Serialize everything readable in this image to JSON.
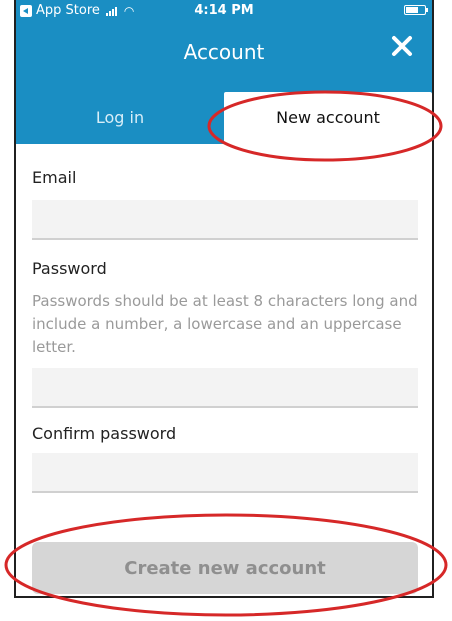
{
  "status_bar": {
    "left_label": "App Store",
    "time": "4:14 PM"
  },
  "header": {
    "title": "Account",
    "close_icon": "close-icon"
  },
  "tabs": [
    {
      "label": "Log in",
      "selected": false
    },
    {
      "label": "New account",
      "selected": true
    }
  ],
  "form": {
    "email_label": "Email",
    "email_value": "",
    "password_label": "Password",
    "password_hint": "Passwords should be at least 8 characters long and include a number, a lowercase and an uppercase letter.",
    "password_value": "",
    "confirm_label": "Confirm password",
    "confirm_value": ""
  },
  "actions": {
    "create_button_label": "Create new account"
  },
  "colors": {
    "header_blue": "#1a8ec3",
    "annotation_red": "#d62828",
    "disabled_button": "#d6d6d6"
  }
}
